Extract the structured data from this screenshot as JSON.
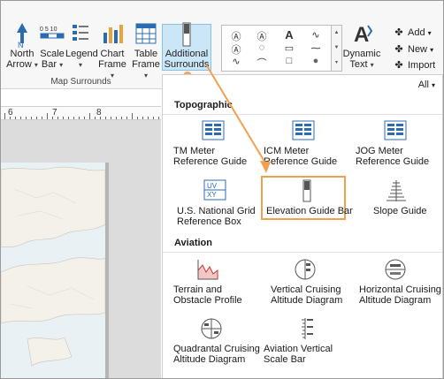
{
  "ribbon": {
    "buttons": [
      {
        "line1": "North",
        "line2": "Arrow"
      },
      {
        "line1": "Scale",
        "line2": "Bar"
      },
      {
        "line1": "Legend",
        "line2": ""
      },
      {
        "line1": "Chart",
        "line2": "Frame"
      },
      {
        "line1": "Table",
        "line2": "Frame"
      },
      {
        "line1": "Additional",
        "line2": "Surrounds"
      }
    ],
    "group_label": "Map Surrounds",
    "dynamic_text": {
      "line1": "Dynamic",
      "line2": "Text"
    },
    "small_commands": [
      "Add",
      "New",
      "Import"
    ],
    "scale_bar_ticks": "0 5 10"
  },
  "ruler": {
    "numbers": [
      "6",
      "7",
      "8"
    ]
  },
  "panel": {
    "filter": "All",
    "sections": [
      {
        "title": "Topographic",
        "items": [
          {
            "label": "TM Meter Reference Guide",
            "icon": "tm-meter-icon"
          },
          {
            "label": "ICM Meter Reference Guide",
            "icon": "icm-meter-icon"
          },
          {
            "label": "JOG Meter Reference Guide",
            "icon": "jog-meter-icon"
          },
          {
            "label": "U.S. National Grid Reference Box",
            "icon": "usng-box-icon"
          },
          {
            "label": "Elevation Guide Bar",
            "icon": "elevation-bar-icon"
          },
          {
            "label": "Slope Guide",
            "icon": "slope-guide-icon"
          }
        ]
      },
      {
        "title": "Aviation",
        "items": [
          {
            "label": "Terrain and Obstacle Profile",
            "icon": "terrain-profile-icon"
          },
          {
            "label": "Vertical Cruising Altitude Diagram",
            "icon": "vertical-altitude-icon"
          },
          {
            "label": "Horizontal Cruising Altitude Diagram",
            "icon": "horizontal-altitude-icon"
          },
          {
            "label": "Quadrantal Cruising Altitude Diagram",
            "icon": "quadrantal-altitude-icon"
          },
          {
            "label": "Aviation Vertical Scale Bar",
            "icon": "aviation-scale-bar-icon"
          }
        ]
      }
    ]
  },
  "colors": {
    "accent": "#f0a050",
    "selected": "#cbe6f7",
    "icon_blue": "#2b6cb0"
  }
}
